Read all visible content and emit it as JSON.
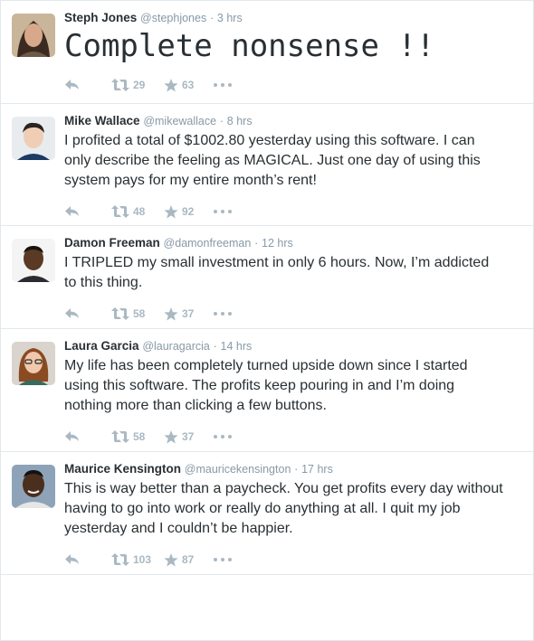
{
  "tweets": [
    {
      "fullname": "Steph Jones",
      "username": "@stephjones",
      "separator": "·",
      "time": "3 hrs",
      "text": "Complete nonsense !!",
      "retweets": "29",
      "favorites": "63",
      "avatar_colors": {
        "bg": "#c9b59a",
        "skin": "#d7a98a",
        "hair": "#3b2a20",
        "shirt": "#6e5a48"
      }
    },
    {
      "fullname": "Mike Wallace",
      "username": "@mikewallace",
      "separator": "·",
      "time": "8 hrs",
      "text": "I profited a total of $1002.80 yesterday using this software. I can only describe the feeling as MAGICAL. Just one day of  using this system pays for my entire month’s rent!",
      "retweets": "48",
      "favorites": "92",
      "avatar_colors": {
        "bg": "#e8ecef",
        "skin": "#f0cdb5",
        "hair": "#2b2320",
        "shirt": "#1d3a63"
      }
    },
    {
      "fullname": "Damon Freeman",
      "username": "@damonfreeman",
      "separator": "·",
      "time": "12 hrs",
      "text": "I TRIPLED my small investment in only 6 hours. Now, I’m addicted to this thing.",
      "retweets": "58",
      "favorites": "37",
      "avatar_colors": {
        "bg": "#f4f4f4",
        "skin": "#5a3a24",
        "hair": "#1b120c",
        "shirt": "#2b2b30"
      }
    },
    {
      "fullname": "Laura Garcia",
      "username": "@lauragarcia",
      "separator": "·",
      "time": "14 hrs",
      "text": "My life has been completely turned upside down since I started using this software. The profits keep pouring in and I’m doing nothing more than clicking a few buttons.",
      "retweets": "58",
      "favorites": "37",
      "avatar_colors": {
        "bg": "#d9d4cd",
        "skin": "#f0c8ad",
        "hair": "#8a4a22",
        "shirt": "#3a6a5a"
      }
    },
    {
      "fullname": "Maurice Kensington",
      "username": "@mauricekensington",
      "separator": "·",
      "time": "17 hrs",
      "text": "This is way better than a paycheck. You get profits every day without having to go into work or really do anything at all. I quit my job yesterday and I couldn’t be happier.",
      "retweets": "103",
      "favorites": "87",
      "avatar_colors": {
        "bg": "#8fa3b8",
        "skin": "#4a2e1e",
        "hair": "#121212",
        "shirt": "#e6e6e6"
      }
    }
  ],
  "colors": {
    "icon_gray": "#aab8c2",
    "meta_gray": "#8899a6",
    "text": "#292f33",
    "border": "#e1e8ed"
  },
  "icons": {
    "reply": "reply-icon",
    "retweet": "retweet-icon",
    "favorite": "star-icon",
    "more": "more-icon"
  }
}
